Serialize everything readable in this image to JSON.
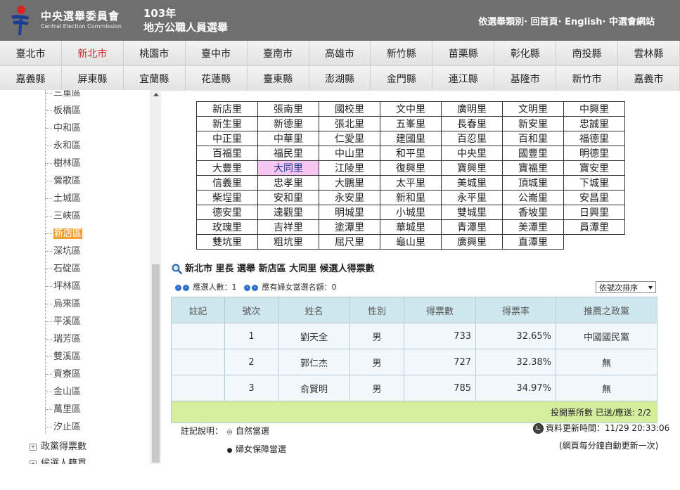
{
  "header": {
    "logo_title": "中央選舉委員會",
    "logo_subtitle": "Central Election Commission",
    "election_year": "103年",
    "election_name": "地方公職人員選舉",
    "links": [
      "依選舉類別",
      "回首頁",
      "English",
      "中選會網站"
    ],
    "link_separator": "·"
  },
  "nav": {
    "row1": [
      "臺北市",
      "新北市",
      "桃園市",
      "臺中市",
      "臺南市",
      "高雄市",
      "新竹縣",
      "苗栗縣",
      "彰化縣",
      "南投縣",
      "雲林縣"
    ],
    "row2": [
      "嘉義縣",
      "屏東縣",
      "宜蘭縣",
      "花蓮縣",
      "臺東縣",
      "澎湖縣",
      "金門縣",
      "連江縣",
      "基隆市",
      "新竹市",
      "嘉義市"
    ],
    "active": "新北市"
  },
  "sidebar": {
    "districts": [
      "三重區",
      "板橋區",
      "中和區",
      "永和區",
      "樹林區",
      "鶯歌區",
      "土城區",
      "三峽區",
      "新店區",
      "深坑區",
      "石碇區",
      "坪林區",
      "烏來區",
      "平溪區",
      "瑞芳區",
      "雙溪區",
      "貢寮區",
      "金山區",
      "萬里區",
      "汐止區"
    ],
    "active_district": "新店區",
    "extra": [
      "政黨得票數",
      "候選人籍貫"
    ]
  },
  "villages": [
    [
      "新店里",
      "張南里",
      "國校里",
      "文中里",
      "廣明里",
      "文明里",
      "中興里"
    ],
    [
      "新生里",
      "新德里",
      "張北里",
      "五峯里",
      "長春里",
      "新安里",
      "忠誠里"
    ],
    [
      "中正里",
      "中華里",
      "仁愛里",
      "建國里",
      "百忍里",
      "百和里",
      "福德里"
    ],
    [
      "百福里",
      "福民里",
      "中山里",
      "和平里",
      "中央里",
      "國豐里",
      "明德里"
    ],
    [
      "大豐里",
      "大同里",
      "江陵里",
      "復興里",
      "寶興里",
      "寶福里",
      "寶安里"
    ],
    [
      "信義里",
      "忠孝里",
      "大鵬里",
      "太平里",
      "美城里",
      "頂城里",
      "下城里"
    ],
    [
      "柴埕里",
      "安和里",
      "永安里",
      "新和里",
      "永平里",
      "公崙里",
      "安昌里"
    ],
    [
      "德安里",
      "達觀里",
      "明城里",
      "小城里",
      "雙城里",
      "香坡里",
      "日興里"
    ],
    [
      "玫瑰里",
      "吉祥里",
      "塗潭里",
      "華城里",
      "青潭里",
      "美潭里",
      "員潭里"
    ],
    [
      "雙坑里",
      "粗坑里",
      "屈尺里",
      "龜山里",
      "廣興里",
      "直潭里",
      ""
    ]
  ],
  "active_village": "大同里",
  "result": {
    "title": "新北市 里長 選舉  新店區 大同里 候選人得票數",
    "elect_count": "應選人數：1",
    "women_quota": "應有婦女當選名額：0",
    "sort_label": "依號次排序",
    "columns": [
      "註記",
      "號次",
      "姓名",
      "性別",
      "得票數",
      "得票率",
      "推薦之政黨"
    ],
    "rows": [
      {
        "note": "",
        "no": "1",
        "name": "劉天全",
        "gender": "男",
        "votes": "733",
        "rate": "32.65%",
        "party": "中國國民黨"
      },
      {
        "no": "2",
        "name": "郭仁杰",
        "gender": "男",
        "votes": "727",
        "rate": "32.38%",
        "party": "無"
      },
      {
        "no": "3",
        "name": "俞賢明",
        "gender": "男",
        "votes": "785",
        "rate": "34.97%",
        "party": "無"
      }
    ],
    "footer": "投開票所數 已送/應送: 2/2"
  },
  "legend": {
    "label": "註記說明：",
    "items": [
      "自然當選",
      "婦女保障當選"
    ]
  },
  "update": {
    "time": "資料更新時間：11/29 20:33:06",
    "auto": "(網頁每分鐘自動更新一次)"
  }
}
